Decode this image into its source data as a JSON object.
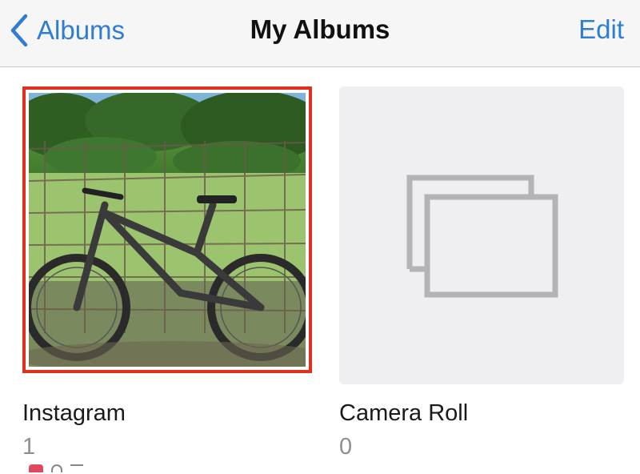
{
  "navbar": {
    "back_label": "Albums",
    "title": "My Albums",
    "edit_label": "Edit"
  },
  "albums": [
    {
      "title": "Instagram",
      "count": "1",
      "thumbnail": "bicycle-photo",
      "selected": true,
      "selection_color": "#e0301e"
    },
    {
      "title": "Camera Roll",
      "count": "0",
      "thumbnail": "empty-album-icon",
      "selected": false
    }
  ],
  "colors": {
    "accent": "#2f7dd1",
    "nav_background": "#f6f6f7",
    "placeholder_background": "#efeff2"
  }
}
